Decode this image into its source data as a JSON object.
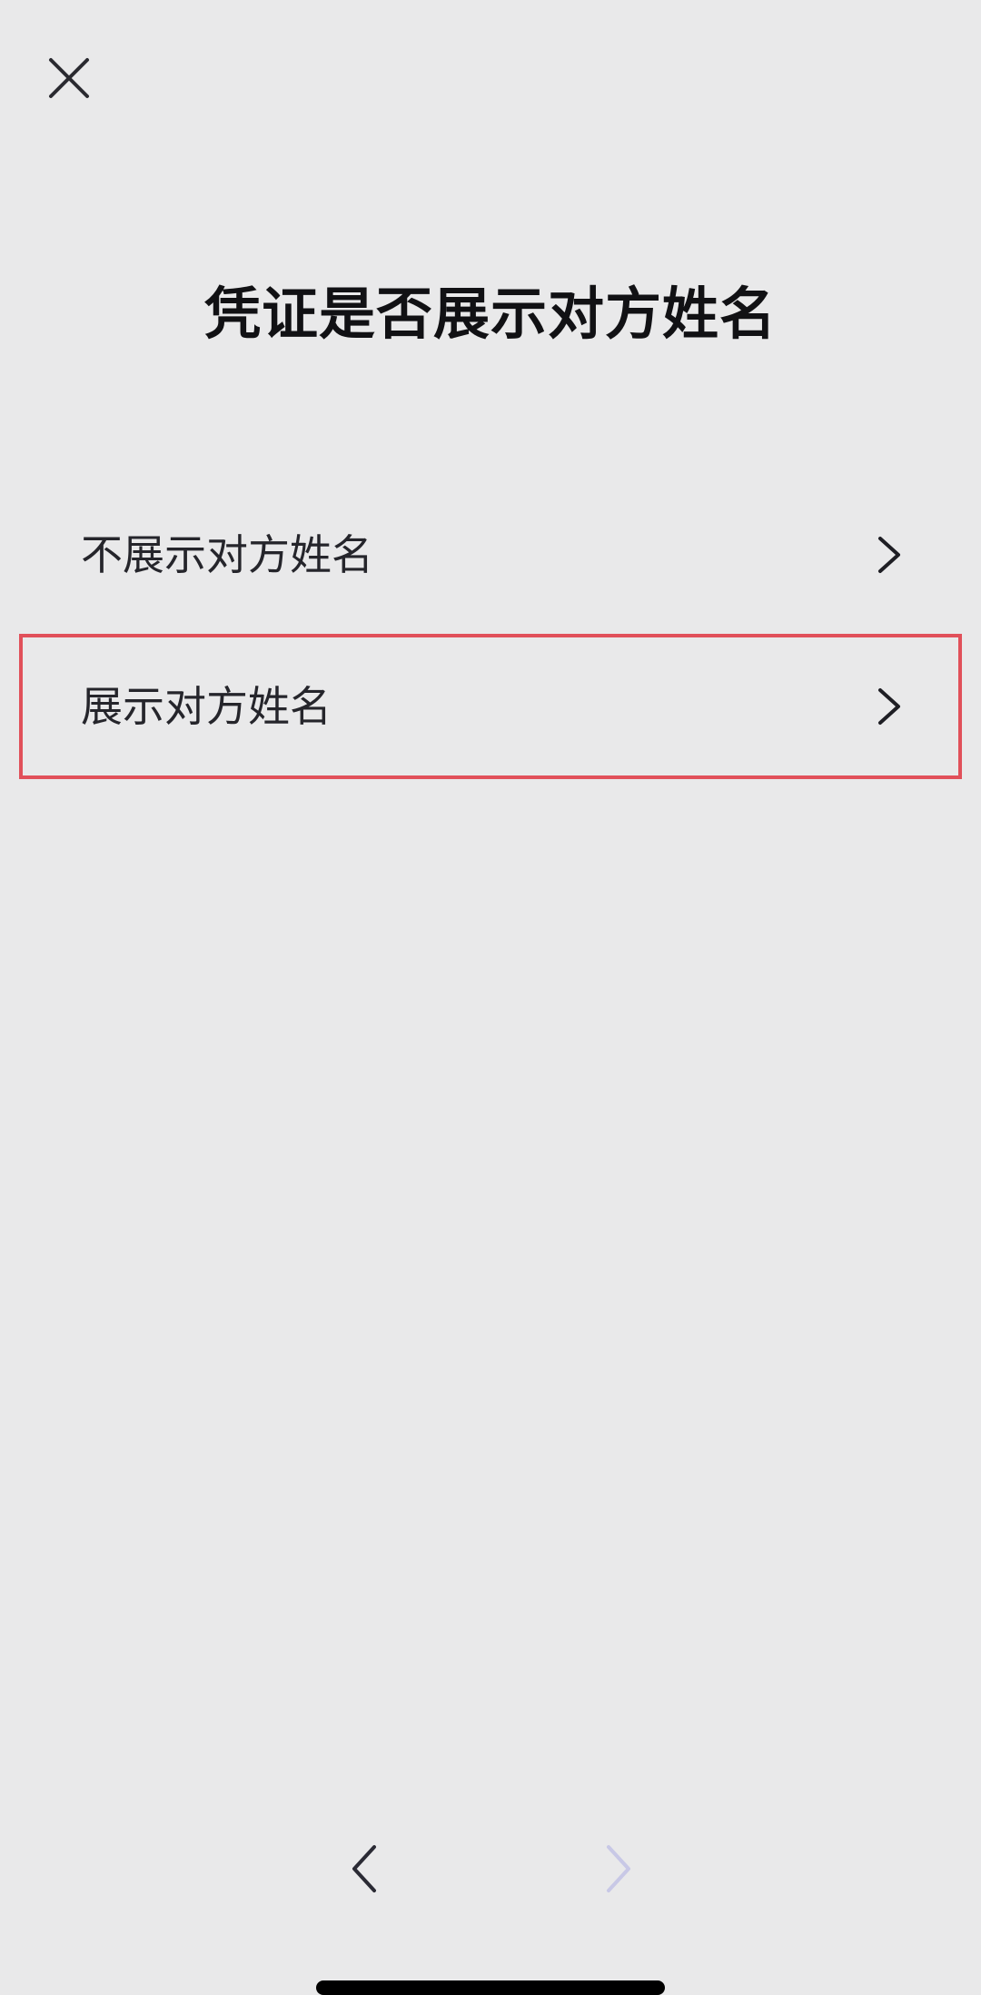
{
  "page": {
    "title": "凭证是否展示对方姓名"
  },
  "options": [
    {
      "label": "不展示对方姓名",
      "icon": "chevron-right-icon",
      "highlighted": false
    },
    {
      "label": "展示对方姓名",
      "icon": "chevron-right-icon",
      "highlighted": true
    }
  ],
  "icons": {
    "close": "close-icon",
    "prev": "chevron-left-icon",
    "next": "chevron-right-icon"
  },
  "colors": {
    "background": "#e9e9ea",
    "highlight_border": "#e1505a",
    "next_disabled": "#c8c8e6"
  }
}
